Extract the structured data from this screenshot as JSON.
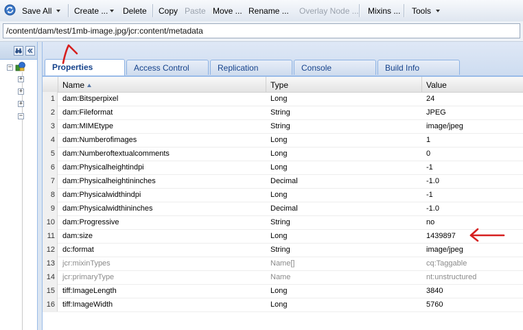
{
  "toolbar": {
    "items": [
      {
        "label": "Save All",
        "dropdown": true,
        "disabled": false
      },
      {
        "label": "Create ...",
        "dropdown": true,
        "disabled": false
      },
      {
        "label": "Delete",
        "dropdown": false,
        "disabled": false
      },
      {
        "label": "Copy",
        "dropdown": false,
        "disabled": false
      },
      {
        "label": "Paste",
        "dropdown": false,
        "disabled": true
      },
      {
        "label": "Move ...",
        "dropdown": false,
        "disabled": false
      },
      {
        "label": "Rename ...",
        "dropdown": false,
        "disabled": false
      },
      {
        "label": "Overlay Node ...",
        "dropdown": false,
        "disabled": true
      },
      {
        "label": "Mixins ...",
        "dropdown": false,
        "disabled": false
      },
      {
        "label": "Tools",
        "dropdown": true,
        "disabled": false
      }
    ]
  },
  "path": {
    "value": "/content/dam/test/1mb-image.jpg/jcr:content/metadata"
  },
  "tree": {
    "expand_buttons": [
      "+",
      "+",
      "+",
      "−"
    ],
    "root_expander": "−"
  },
  "tabs": [
    {
      "label": "Properties",
      "active": true
    },
    {
      "label": "Access Control",
      "active": false
    },
    {
      "label": "Replication",
      "active": false
    },
    {
      "label": "Console",
      "active": false
    },
    {
      "label": "Build Info",
      "active": false
    }
  ],
  "grid": {
    "columns": {
      "name": "Name",
      "type": "Type",
      "value": "Value"
    },
    "rows": [
      {
        "num": "1",
        "name": "dam:Bitsperpixel",
        "type": "Long",
        "value": "24",
        "protected": false
      },
      {
        "num": "2",
        "name": "dam:Fileformat",
        "type": "String",
        "value": "JPEG",
        "protected": false
      },
      {
        "num": "3",
        "name": "dam:MIMEtype",
        "type": "String",
        "value": "image/jpeg",
        "protected": false
      },
      {
        "num": "4",
        "name": "dam:Numberofimages",
        "type": "Long",
        "value": "1",
        "protected": false
      },
      {
        "num": "5",
        "name": "dam:Numberoftextualcomments",
        "type": "Long",
        "value": "0",
        "protected": false
      },
      {
        "num": "6",
        "name": "dam:Physicalheightindpi",
        "type": "Long",
        "value": "-1",
        "protected": false
      },
      {
        "num": "7",
        "name": "dam:Physicalheightininches",
        "type": "Decimal",
        "value": "-1.0",
        "protected": false
      },
      {
        "num": "8",
        "name": "dam:Physicalwidthindpi",
        "type": "Long",
        "value": "-1",
        "protected": false
      },
      {
        "num": "9",
        "name": "dam:Physicalwidthininches",
        "type": "Decimal",
        "value": "-1.0",
        "protected": false
      },
      {
        "num": "10",
        "name": "dam:Progressive",
        "type": "String",
        "value": "no",
        "protected": false
      },
      {
        "num": "11",
        "name": "dam:size",
        "type": "Long",
        "value": "1439897",
        "protected": false
      },
      {
        "num": "12",
        "name": "dc:format",
        "type": "String",
        "value": "image/jpeg",
        "protected": false
      },
      {
        "num": "13",
        "name": "jcr:mixinTypes",
        "type": "Name[]",
        "value": "cq:Taggable",
        "protected": true
      },
      {
        "num": "14",
        "name": "jcr:primaryType",
        "type": "Name",
        "value": "nt:unstructured",
        "protected": true
      },
      {
        "num": "15",
        "name": "tiff:ImageLength",
        "type": "Long",
        "value": "3840",
        "protected": false
      },
      {
        "num": "16",
        "name": "tiff:ImageWidth",
        "type": "Long",
        "value": "5760",
        "protected": false
      }
    ]
  },
  "colors": {
    "annotation": "#d61f1f",
    "tab_text": "#15428b",
    "panel_border": "#99bbe8"
  }
}
